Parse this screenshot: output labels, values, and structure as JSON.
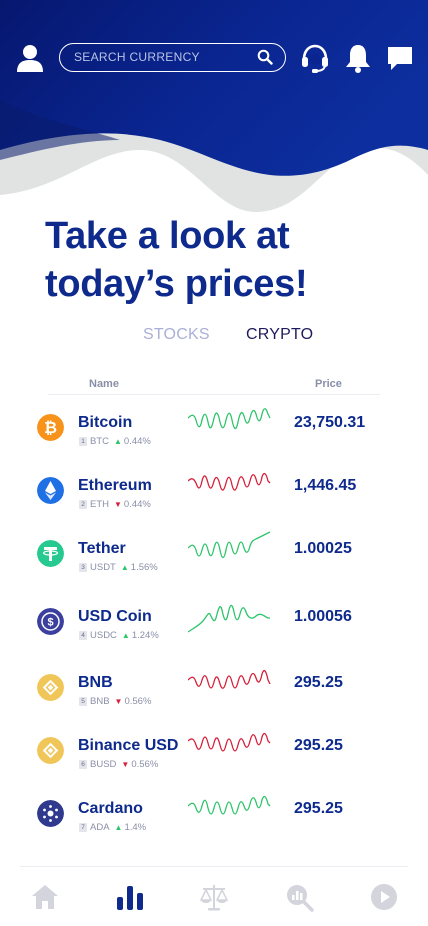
{
  "header": {
    "search_placeholder": "SEARCH CURRENCY",
    "icons": [
      "user-icon",
      "search-icon",
      "headset-icon",
      "bell-icon",
      "chat-icon"
    ]
  },
  "headline": "Take a look at today’s prices!",
  "tabs": {
    "stocks": "STOCKS",
    "crypto": "CRYPTO",
    "active": "crypto"
  },
  "table": {
    "col_name": "Name",
    "col_price": "Price"
  },
  "coins": [
    {
      "name": "Bitcoin",
      "rank": "1",
      "symbol": "BTC",
      "change": "0.44%",
      "direction": "up",
      "price": "23,750.31",
      "icon": "bitcoin-icon",
      "color": "#f7931a"
    },
    {
      "name": "Ethereum",
      "rank": "2",
      "symbol": "ETH",
      "change": "0.44%",
      "direction": "down",
      "price": "1,446.45",
      "icon": "ethereum-icon",
      "color": "#1f6fe5"
    },
    {
      "name": "Tether",
      "rank": "3",
      "symbol": "USDT",
      "change": "1.56%",
      "direction": "up",
      "price": "1.00025",
      "icon": "tether-icon",
      "color": "#26c98f"
    },
    {
      "name": "USD Coin",
      "rank": "4",
      "symbol": "USDC",
      "change": "1.24%",
      "direction": "up",
      "price": "1.00056",
      "icon": "usd-coin-icon",
      "color": "#3b3f9e"
    },
    {
      "name": "BNB",
      "rank": "5",
      "symbol": "BNB",
      "change": "0.56%",
      "direction": "down",
      "price": "295.25",
      "icon": "bnb-icon",
      "color": "#f0c659"
    },
    {
      "name": "Binance USD",
      "rank": "6",
      "symbol": "BUSD",
      "change": "0.56%",
      "direction": "down",
      "price": "295.25",
      "icon": "binance-usd-icon",
      "color": "#f0c659"
    },
    {
      "name": "Cardano",
      "rank": "7",
      "symbol": "ADA",
      "change": "1.4%",
      "direction": "up",
      "price": "295.25",
      "icon": "cardano-icon",
      "color": "#2f3a8f"
    }
  ],
  "colors": {
    "brand": "#0d2a8c",
    "up": "#2ec46b",
    "down": "#d6203a",
    "inactive_tab": "#a9b0d6",
    "nav_inactive": "#d3d4dc"
  },
  "bottom_nav": [
    {
      "icon": "home-icon",
      "active": false
    },
    {
      "icon": "bar-chart-icon",
      "active": true
    },
    {
      "icon": "scale-icon",
      "active": false
    },
    {
      "icon": "analytics-search-icon",
      "active": false
    },
    {
      "icon": "play-icon",
      "active": false
    }
  ]
}
